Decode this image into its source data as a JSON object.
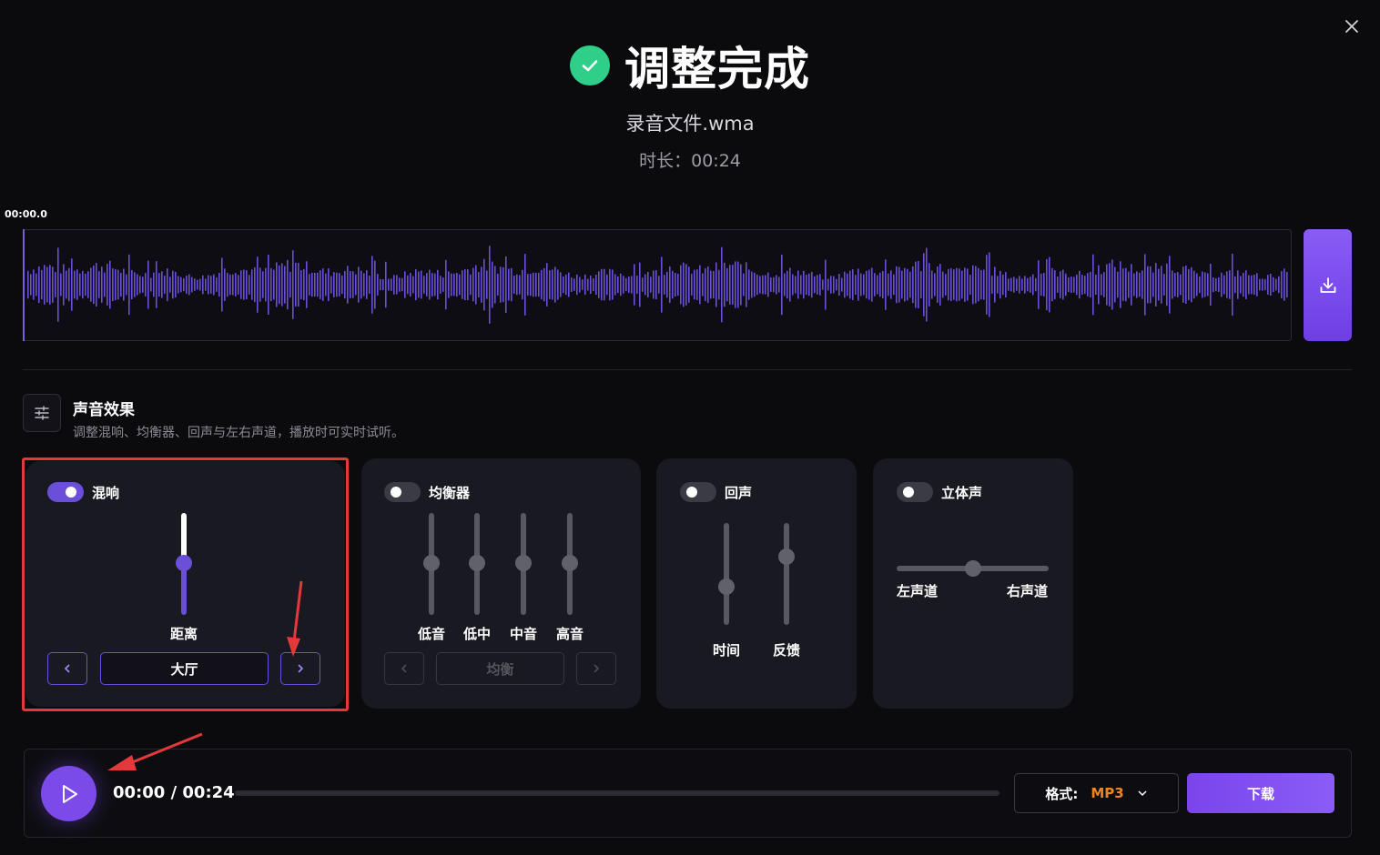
{
  "header": {
    "title": "调整完成",
    "filename": "录音文件.wma",
    "duration_label": "时长：",
    "duration_value": "00:24"
  },
  "waveform": {
    "time_marker": "00:00.0",
    "color": "#6b4fd8"
  },
  "effects": {
    "title": "声音效果",
    "description": "调整混响、均衡器、回声与左右声道，播放时可实时试听。",
    "reverb": {
      "label": "混响",
      "enabled": true,
      "slider_label": "距离",
      "distance_level": 0.5,
      "preset": "大厅"
    },
    "equalizer": {
      "label": "均衡器",
      "enabled": false,
      "bands": [
        "低音",
        "低中",
        "中音",
        "高音"
      ],
      "levels": [
        0.5,
        0.5,
        0.5,
        0.5
      ],
      "preset": "均衡"
    },
    "echo": {
      "label": "回声",
      "enabled": false,
      "sliders": [
        "时间",
        "反馈"
      ],
      "levels": [
        0.38,
        0.67
      ]
    },
    "stereo": {
      "label": "立体声",
      "enabled": false,
      "left_label": "左声道",
      "right_label": "右声道",
      "balance": 0.5
    }
  },
  "player": {
    "time": "00:00 / 00:24",
    "progress": 0,
    "format_label": "格式:",
    "format_value": "MP3",
    "download_label": "下载"
  },
  "colors": {
    "accent": "#7c4ae8",
    "success": "#2fcf8a",
    "format_value": "#f0851f",
    "annotation": "#e5383b"
  }
}
